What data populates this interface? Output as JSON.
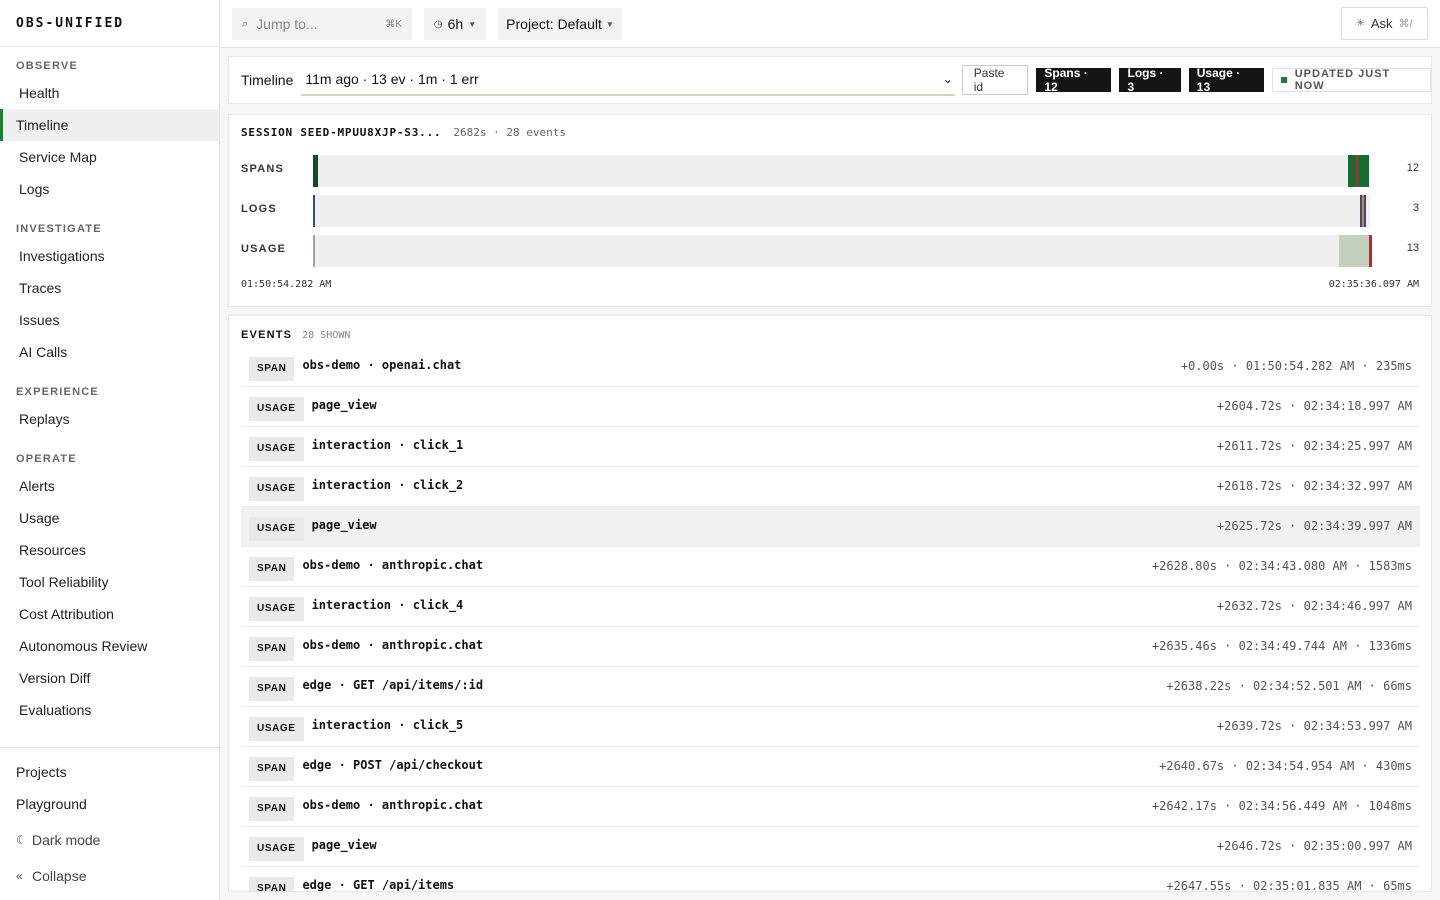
{
  "brand": "OBS-UNIFIED",
  "sidebar": {
    "sections": [
      {
        "title": "OBSERVE",
        "items": [
          "Health",
          "Timeline",
          "Service Map",
          "Logs"
        ]
      },
      {
        "title": "INVESTIGATE",
        "items": [
          "Investigations",
          "Traces",
          "Issues",
          "AI Calls"
        ]
      },
      {
        "title": "EXPERIENCE",
        "items": [
          "Replays"
        ]
      },
      {
        "title": "OPERATE",
        "items": [
          "Alerts",
          "Usage",
          "Resources",
          "Tool Reliability",
          "Cost Attribution",
          "Autonomous Review",
          "Version Diff",
          "Evaluations"
        ]
      }
    ],
    "active": "Timeline",
    "footer": {
      "projects": "Projects",
      "playground": "Playground",
      "dark_mode": "Dark mode",
      "collapse": "Collapse"
    }
  },
  "topbar": {
    "jump_placeholder": "Jump to...",
    "jump_shortcut": "⌘K",
    "range": "6h",
    "project": "Project: Default",
    "ask": "Ask",
    "ask_shortcut": "⌘/"
  },
  "timeline_bar": {
    "label": "Timeline",
    "selected_session": "11m ago · 13 ev · 1m · 1 err",
    "paste_label": "Paste id",
    "pills": [
      "Spans · 12",
      "Logs · 3",
      "Usage · 13"
    ],
    "updated": "UPDATED JUST NOW"
  },
  "session": {
    "title": "SESSION SEED-MPUU8XJP-S3...",
    "meta": "2682s · 28 events",
    "lanes": [
      {
        "label": "SPANS",
        "count": "12"
      },
      {
        "label": "LOGS",
        "count": "3"
      },
      {
        "label": "USAGE",
        "count": "13"
      }
    ],
    "start": "01:50:54.282 AM",
    "end": "02:35:36.097 AM"
  },
  "colors": {
    "accent": "#1b7f3a",
    "error": "#c0262d",
    "log_blue": "#2a4d8f",
    "usage_fill": "#c4cfbd"
  },
  "events": {
    "title": "EVENTS",
    "count": "28 SHOWN",
    "rows": [
      {
        "tag": "SPAN",
        "name": "obs-demo · openai.chat",
        "meta": "+0.00s · 01:50:54.282 AM · 235ms"
      },
      {
        "tag": "USAGE",
        "name": "page_view",
        "meta": "+2604.72s · 02:34:18.997 AM"
      },
      {
        "tag": "USAGE",
        "name": "interaction · click_1",
        "meta": "+2611.72s · 02:34:25.997 AM"
      },
      {
        "tag": "USAGE",
        "name": "interaction · click_2",
        "meta": "+2618.72s · 02:34:32.997 AM"
      },
      {
        "tag": "USAGE",
        "name": "page_view",
        "meta": "+2625.72s · 02:34:39.997 AM",
        "highlight": true
      },
      {
        "tag": "SPAN",
        "name": "obs-demo · anthropic.chat",
        "meta": "+2628.80s · 02:34:43.080 AM · 1583ms"
      },
      {
        "tag": "USAGE",
        "name": "interaction · click_4",
        "meta": "+2632.72s · 02:34:46.997 AM"
      },
      {
        "tag": "SPAN",
        "name": "obs-demo · anthropic.chat",
        "meta": "+2635.46s · 02:34:49.744 AM · 1336ms"
      },
      {
        "tag": "SPAN",
        "name": "edge · GET /api/items/:id",
        "meta": "+2638.22s · 02:34:52.501 AM · 66ms"
      },
      {
        "tag": "USAGE",
        "name": "interaction · click_5",
        "meta": "+2639.72s · 02:34:53.997 AM"
      },
      {
        "tag": "SPAN",
        "name": "edge · POST /api/checkout",
        "meta": "+2640.67s · 02:34:54.954 AM · 430ms"
      },
      {
        "tag": "SPAN",
        "name": "obs-demo · anthropic.chat",
        "meta": "+2642.17s · 02:34:56.449 AM · 1048ms"
      },
      {
        "tag": "USAGE",
        "name": "page_view",
        "meta": "+2646.72s · 02:35:00.997 AM"
      },
      {
        "tag": "SPAN",
        "name": "edge · GET /api/items",
        "meta": "+2647.55s · 02:35:01.835 AM · 65ms"
      }
    ]
  }
}
